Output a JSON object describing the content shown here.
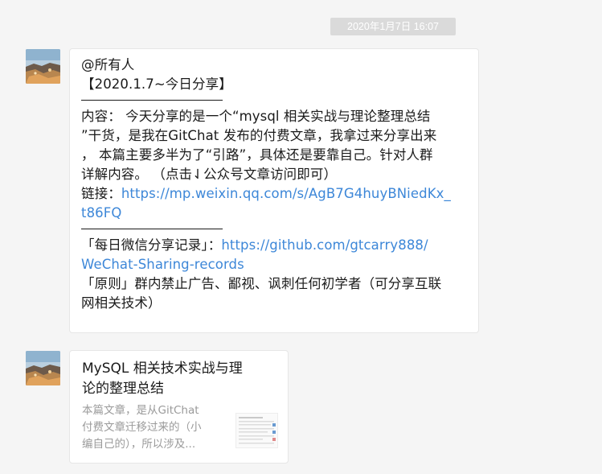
{
  "timestamp": "2020年1月7日 16:07",
  "message": {
    "mention": "@所有人",
    "heading": "【2020.1.7~今日分享】",
    "content_lines": [
      "内容：  今天分享的是一个“mysql  相关实战与理论整理总结",
      "”干货，是我在GitChat 发布的付费文章，我拿过来分享出来",
      "，  本篇主要多半为了“引路”，具体还是要靠自己。针对人群",
      "详解内容。  （点击⇃公众号文章访问即可）"
    ],
    "link_label": "链接：",
    "link_url_line1": "https://mp.weixin.qq.com/s/AgB7G4huyBNiedKx_",
    "link_url_line2": "t86FQ",
    "record_label": "「每日微信分享记录」：",
    "record_url_line1": "https://github.com/gtcarry888/",
    "record_url_line2": "WeChat-Sharing-records",
    "principle_line1": "「原则」群内禁止广告、鄙视、讽刺任何初学者（可分享互联",
    "principle_line2": "网相关技术）"
  },
  "article_card": {
    "title_line1": "MySQL 相关技术实战与理",
    "title_line2": "论的整理总结",
    "desc_line1": "本篇文章，是从GitChat",
    "desc_line2": "付费文章迁移过来的（小",
    "desc_line3": "编自己的），所以涉及..."
  },
  "colors": {
    "background": "#f5f5f5",
    "bubble": "#ffffff",
    "link": "#3d87d8",
    "timestamp_bg": "#dadada"
  }
}
